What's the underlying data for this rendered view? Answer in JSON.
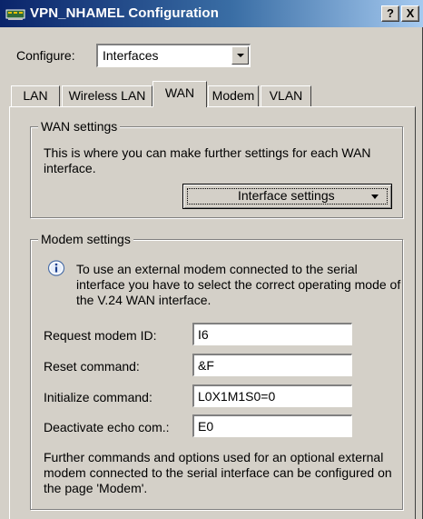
{
  "window": {
    "title": "VPN_NHAMEL Configuration",
    "help_label": "?",
    "close_label": "X"
  },
  "configure": {
    "label": "Configure:",
    "value": "Interfaces"
  },
  "tabs": [
    {
      "label": "LAN",
      "active": false
    },
    {
      "label": "Wireless LAN",
      "active": false
    },
    {
      "label": "WAN",
      "active": true
    },
    {
      "label": "Modem",
      "active": false
    },
    {
      "label": "VLAN",
      "active": false
    }
  ],
  "wan_settings": {
    "legend": "WAN settings",
    "description_line1": "This is where you can make further settings for each WAN",
    "description_line2": "interface.",
    "button_label": "Interface settings"
  },
  "modem_settings": {
    "legend": "Modem settings",
    "info_line1": "To use an external modem connected to the serial",
    "info_line2": "interface you have to select the correct operating mode of",
    "info_line3": "the V.24 WAN interface.",
    "fields": [
      {
        "label": "Request modem ID:",
        "value": "I6"
      },
      {
        "label": "Reset command:",
        "value": "&F"
      },
      {
        "label": "Initialize command:",
        "value": "L0X1M1S0=0"
      },
      {
        "label": "Deactivate echo com.:",
        "value": "E0"
      }
    ],
    "footer_line1": "Further commands and options used for an optional external",
    "footer_line2": "modem connected to the serial interface can be configured on",
    "footer_line3": "the page 'Modem'."
  },
  "colors": {
    "titlebar_start": "#0a246a",
    "titlebar_end": "#a6caf0",
    "dialog_face": "#d4d0c8"
  },
  "icons": {
    "title": "network-card-icon",
    "info": "info-icon"
  }
}
